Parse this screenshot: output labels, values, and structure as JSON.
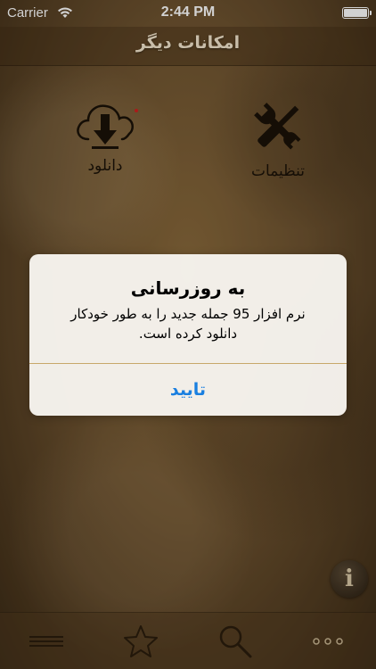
{
  "status_bar": {
    "carrier": "Carrier",
    "time": "2:44 PM"
  },
  "nav": {
    "title": "امکانات دیگر"
  },
  "menu": {
    "items": [
      {
        "label": "دانلود",
        "icon": "cloud-download-icon"
      },
      {
        "label": "تنظیمات",
        "icon": "wrench-screwdriver-icon"
      }
    ]
  },
  "alert": {
    "title": "به روزرسانی",
    "message": "نرم افزار 95 جمله جدید را به طور خودکار دانلود کرده است.",
    "confirm_label": "تایید"
  },
  "info_button": {
    "icon": "info-icon",
    "glyph": "i"
  },
  "tab_bar": {
    "tabs": [
      {
        "icon": "hamburger-menu-icon"
      },
      {
        "icon": "star-icon"
      },
      {
        "icon": "search-icon"
      },
      {
        "icon": "more-dots-icon"
      }
    ]
  },
  "colors": {
    "alert_button": "#1a7fe0",
    "divider": "#c8a86a",
    "background": "#6e5330"
  }
}
